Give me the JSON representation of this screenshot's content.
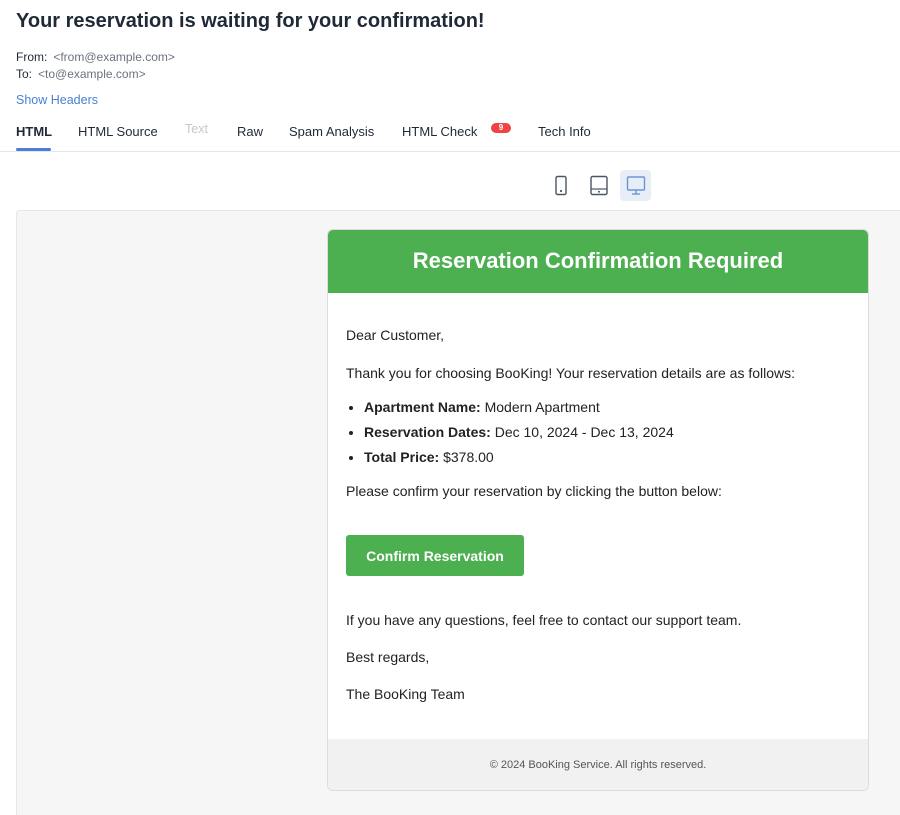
{
  "message": {
    "subject": "Your reservation is waiting for your confirmation!",
    "from_label": "From:",
    "from_address": "<from@example.com>",
    "to_label": "To:",
    "to_address": "<to@example.com>",
    "show_headers": "Show Headers"
  },
  "tabs": {
    "html": "HTML",
    "html_source": "HTML Source",
    "text": "Text",
    "raw": "Raw",
    "spam_analysis": "Spam Analysis",
    "html_check": "HTML Check",
    "html_check_badge": "9",
    "tech_info": "Tech Info",
    "active": "HTML"
  },
  "device_toggles": {
    "items": [
      "mobile-icon",
      "tablet-icon",
      "desktop-icon"
    ],
    "active": "desktop-icon"
  },
  "email": {
    "header_title": "Reservation Confirmation Required",
    "greeting": "Dear Customer,",
    "intro": "Thank you for choosing BooKing! Your reservation details are as follows:",
    "details": [
      {
        "label": "Apartment Name:",
        "value": " Modern Apartment"
      },
      {
        "label": "Reservation Dates:",
        "value": " Dec 10, 2024 - Dec 13, 2024"
      },
      {
        "label": "Total Price:",
        "value": " $378.00"
      }
    ],
    "instruction": "Please confirm your reservation by clicking the button below:",
    "button_label": "Confirm Reservation",
    "questions": "If you have any questions, feel free to contact our support team.",
    "sign_off": "Best regards,",
    "signature": "The BooKing Team",
    "footer": "© 2024 BooKing Service. All rights reserved.",
    "accent_color": "#4caf50"
  },
  "colors": {
    "link": "#4a7fd4",
    "badge": "#ef4444",
    "preview_bg": "#f6f6f6"
  }
}
